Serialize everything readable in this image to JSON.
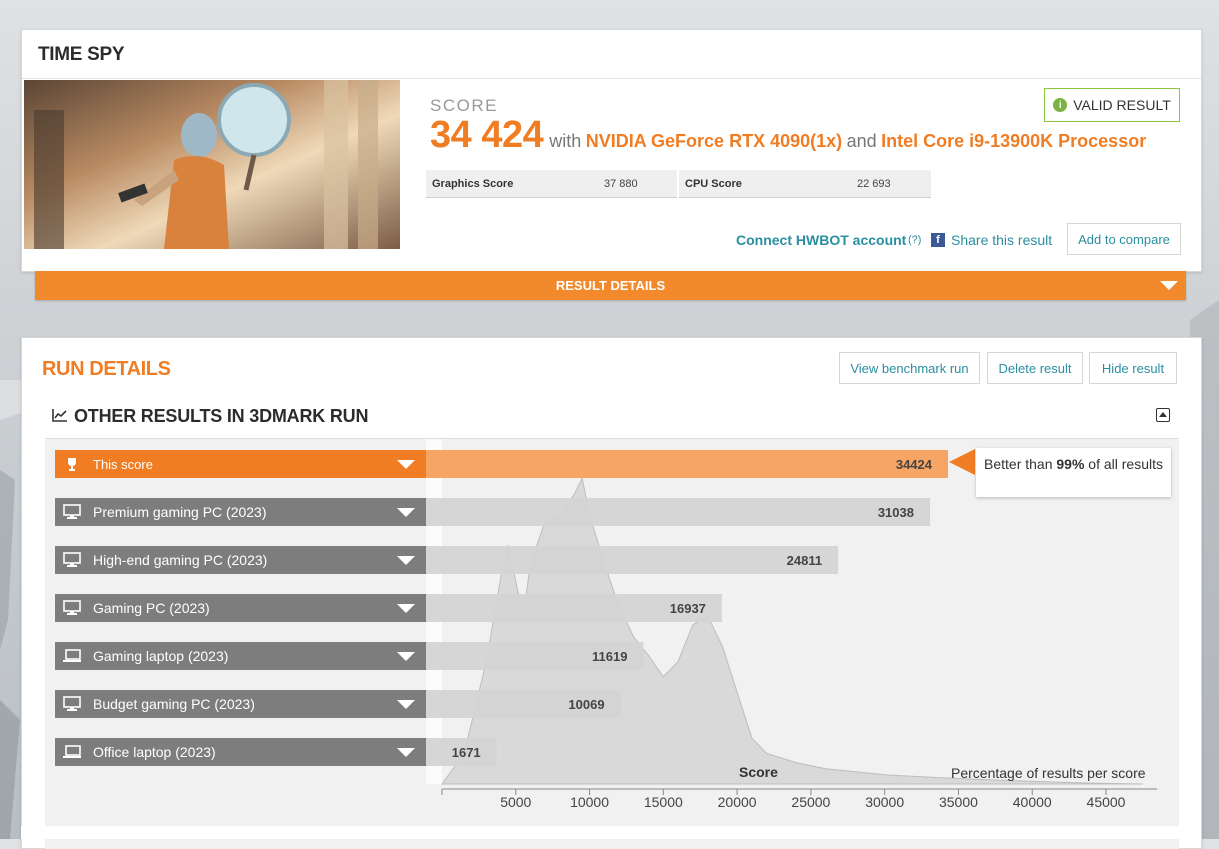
{
  "header": {
    "title": "TIME SPY"
  },
  "score": {
    "label": "SCORE",
    "value": "34 424",
    "with": "with",
    "gpu": "NVIDIA GeForce RTX 4090(1x)",
    "and": "and",
    "cpu": "Intel Core i9-13900K Processor"
  },
  "valid_badge": {
    "icon": "info-circle-icon",
    "label": "VALID RESULT"
  },
  "subscores": [
    {
      "label": "Graphics Score",
      "value": "37 880"
    },
    {
      "label": "CPU Score",
      "value": "22 693"
    }
  ],
  "links": {
    "hwbot": "Connect HWBOT account",
    "hwbot_help": "(?)",
    "share": "Share this result",
    "add_compare": "Add to compare"
  },
  "result_details": {
    "label": "RESULT DETAILS"
  },
  "run_details": {
    "title": "RUN DETAILS",
    "buttons": {
      "view": "View benchmark run",
      "delete": "Delete result",
      "hide": "Hide result"
    }
  },
  "other_results": {
    "title": "OTHER RESULTS IN 3DMARK RUN",
    "better_than_prefix": "Better than ",
    "better_than_pct": "99%",
    "better_than_suffix": " of all results",
    "axis_title": "Score",
    "axis_pct_label": "Percentage of results per score"
  },
  "colors": {
    "accent": "#f07d23",
    "accent_light": "#f7a564",
    "link": "#2a8fa0",
    "valid": "#8cc63f",
    "bar_grey": "#d4d4d4",
    "label_grey": "#7d7d7d"
  },
  "chart_data": {
    "type": "bar",
    "orientation": "horizontal",
    "categories": [
      "This score",
      "Premium gaming PC (2023)",
      "High-end gaming PC (2023)",
      "Gaming PC (2023)",
      "Gaming laptop (2023)",
      "Budget gaming PC (2023)",
      "Office laptop (2023)"
    ],
    "icons": [
      "trophy-icon",
      "desktop-icon",
      "desktop-icon",
      "desktop-icon",
      "laptop-icon",
      "desktop-icon",
      "laptop-icon"
    ],
    "values": [
      34424,
      31038,
      24811,
      16937,
      11619,
      10069,
      1671
    ],
    "xlabel": "Score",
    "xlim": [
      0,
      48000
    ],
    "xticks": [
      5000,
      10000,
      15000,
      20000,
      25000,
      30000,
      35000,
      40000,
      45000
    ],
    "distribution": {
      "label": "Percentage of results per score",
      "x": [
        0,
        1500,
        3000,
        4000,
        4500,
        5000,
        5500,
        6000,
        7000,
        8000,
        9000,
        9500,
        10000,
        11000,
        12000,
        13000,
        14000,
        15000,
        16000,
        17000,
        18000,
        19000,
        20000,
        21000,
        22000,
        24000,
        26000,
        28000,
        30000,
        32000,
        34000,
        36000,
        38000,
        40000,
        42000,
        44000,
        47500
      ],
      "y": [
        0,
        10,
        40,
        68,
        78,
        66,
        55,
        72,
        86,
        88,
        95,
        100,
        88,
        72,
        58,
        48,
        42,
        35,
        40,
        52,
        55,
        45,
        30,
        15,
        10,
        7,
        5,
        4,
        3,
        2.5,
        2,
        1.6,
        1.2,
        0.9,
        0.6,
        0.3,
        0
      ]
    }
  }
}
